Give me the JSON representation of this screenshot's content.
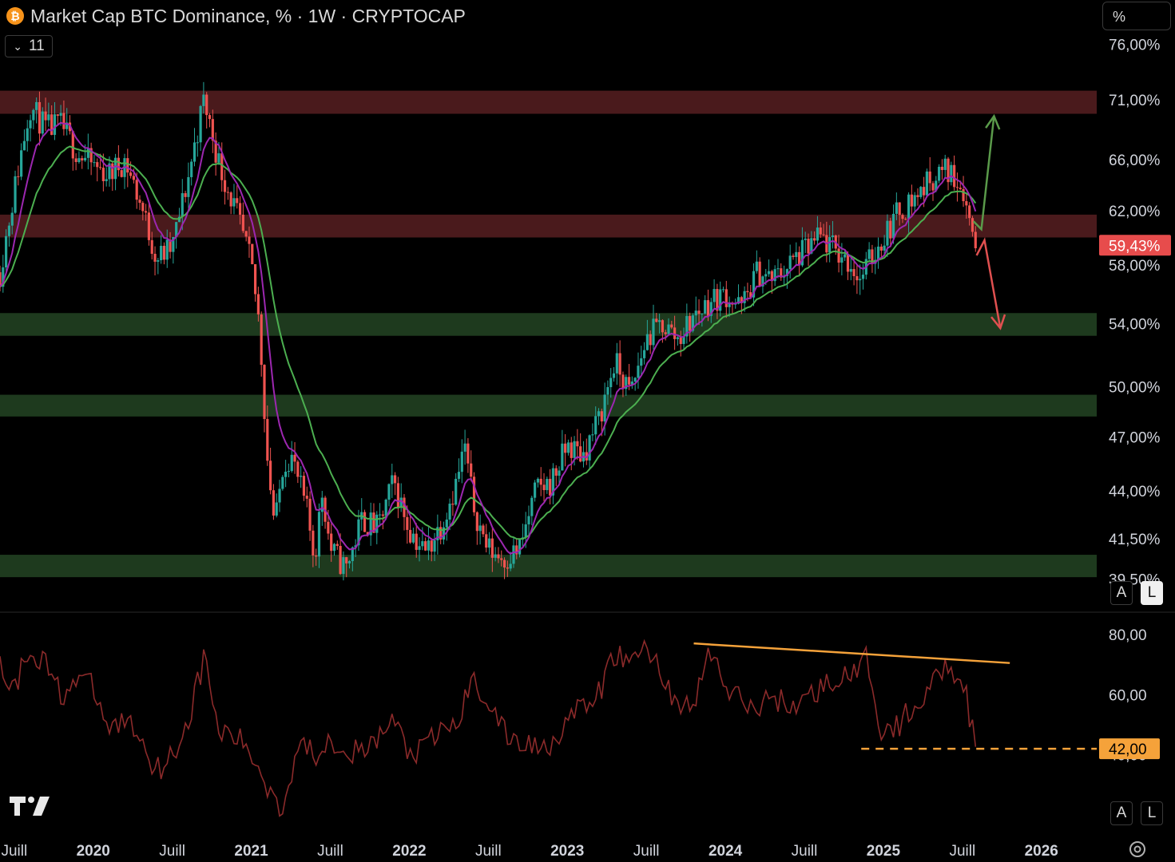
{
  "header": {
    "coin_icon": "bitcoin-icon",
    "title": "Market Cap BTC Dominance, % · 1W · CRYPTOCAP",
    "indicators_count": "11",
    "scale_label": "%"
  },
  "scale_buttons": {
    "auto": "A",
    "log": "L"
  },
  "colors": {
    "background": "#000000",
    "up_candle": "#26a69a",
    "down_candle": "#ef5350",
    "ema_fast": "#9c27b0",
    "ema_slow": "#4caf50",
    "resistance_zone": "#4a1a1c",
    "support_zone": "#1e3a1e",
    "rsi_line": "#8b2a2a",
    "trendline": "#f5a23a",
    "last_price_label": "#e74c4c"
  },
  "chart_data": [
    {
      "type": "candlestick",
      "title": "Market Cap BTC Dominance, % · 1W · CRYPTOCAP",
      "ylabel": "%",
      "y_scale": "log",
      "ylim": [
        38.2,
        77.0
      ],
      "y_ticks": [
        "76,00%",
        "71,00%",
        "66,00%",
        "62,00%",
        "58,00%",
        "54,00%",
        "50,00%",
        "47,00%",
        "44,00%",
        "41,50%",
        "39,50%"
      ],
      "y_tick_values": [
        76,
        71,
        66,
        62,
        58,
        54,
        50,
        47,
        44,
        41.5,
        39.5
      ],
      "x_ticks": [
        "Juill",
        "2020",
        "Juill",
        "2021",
        "Juill",
        "2022",
        "Juill",
        "2023",
        "Juill",
        "2024",
        "Juill",
        "2025",
        "Juill",
        "2026"
      ],
      "x_tick_values": [
        2019.5,
        2020.0,
        2020.5,
        2021.0,
        2021.5,
        2022.0,
        2022.5,
        2023.0,
        2023.5,
        2024.0,
        2024.5,
        2025.0,
        2025.5,
        2026.0
      ],
      "xlim": [
        2019.41,
        2026.35
      ],
      "last_value": 59.43,
      "last_value_label": "59,43%",
      "series": [
        {
          "name": "",
          "kind": "close",
          "x": [
            2019.41,
            2019.5,
            2019.6,
            2019.7,
            2019.8,
            2019.9,
            2020.0,
            2020.1,
            2020.2,
            2020.3,
            2020.4,
            2020.5,
            2020.6,
            2020.7,
            2020.8,
            2020.9,
            2020.95,
            2021.0,
            2021.05,
            2021.1,
            2021.15,
            2021.2,
            2021.25,
            2021.3,
            2021.35,
            2021.4,
            2021.45,
            2021.5,
            2021.6,
            2021.7,
            2021.8,
            2021.9,
            2022.0,
            2022.1,
            2022.2,
            2022.3,
            2022.35,
            2022.4,
            2022.45,
            2022.5,
            2022.6,
            2022.7,
            2022.8,
            2022.9,
            2023.0,
            2023.1,
            2023.2,
            2023.3,
            2023.4,
            2023.5,
            2023.6,
            2023.7,
            2023.8,
            2023.9,
            2024.0,
            2024.1,
            2024.2,
            2024.3,
            2024.4,
            2024.5,
            2024.6,
            2024.7,
            2024.8,
            2024.85,
            2024.9,
            2024.95,
            2025.0,
            2025.1,
            2025.2,
            2025.3,
            2025.4,
            2025.5,
            2025.55,
            2025.58,
            2025.6
          ],
          "y": [
            57.5,
            63.5,
            70.5,
            68.5,
            68.8,
            66.5,
            65.5,
            64.8,
            66.0,
            62.5,
            58.5,
            59.2,
            64.5,
            71.0,
            65.5,
            62.0,
            60.0,
            58.0,
            54.0,
            46.0,
            42.0,
            45.5,
            46.0,
            44.5,
            43.0,
            40.5,
            44.0,
            41.0,
            40.0,
            42.5,
            42.0,
            44.5,
            42.0,
            40.8,
            42.2,
            44.5,
            46.5,
            43.5,
            42.0,
            41.0,
            40.5,
            41.0,
            44.0,
            44.5,
            46.5,
            46.0,
            48.0,
            51.5,
            49.5,
            53.0,
            54.0,
            53.0,
            54.5,
            55.5,
            56.0,
            55.0,
            57.5,
            57.0,
            58.0,
            59.0,
            60.0,
            59.0,
            58.0,
            57.0,
            58.0,
            59.0,
            60.0,
            62.0,
            63.0,
            64.5,
            65.2,
            64.0,
            61.0,
            60.0,
            59.43
          ]
        },
        {
          "name": "",
          "kind": "ema_fast"
        },
        {
          "name": "",
          "kind": "ema_slow"
        }
      ],
      "zones": [
        {
          "kind": "resistance",
          "from": 69.8,
          "to": 71.8
        },
        {
          "kind": "resistance",
          "from": 60.0,
          "to": 61.7
        },
        {
          "kind": "support",
          "from": 53.2,
          "to": 54.7
        },
        {
          "kind": "support",
          "from": 48.2,
          "to": 49.5
        },
        {
          "kind": "support",
          "from": 39.6,
          "to": 40.7
        }
      ],
      "projections": [
        {
          "kind": "bullish",
          "color": "#5a9a4a",
          "path": [
            [
              2025.57,
              61.2
            ],
            [
              2025.62,
              60.6
            ],
            [
              2025.7,
              69.6
            ]
          ]
        },
        {
          "kind": "bearish",
          "color": "#e05050",
          "path": [
            [
              2025.59,
              58.7
            ],
            [
              2025.64,
              59.8
            ],
            [
              2025.74,
              53.7
            ]
          ]
        }
      ],
      "grid": false
    },
    {
      "type": "line",
      "title": "",
      "ylim": [
        15,
        85
      ],
      "y_ticks": [
        "80,00",
        "60,00",
        "40,00"
      ],
      "y_tick_values": [
        80,
        60,
        40
      ],
      "highlighted_level": "42,00",
      "highlighted_value": 42,
      "series": [
        {
          "name": "",
          "x": [
            2019.41,
            2019.5,
            2019.6,
            2019.7,
            2019.8,
            2019.9,
            2020.0,
            2020.1,
            2020.2,
            2020.3,
            2020.4,
            2020.5,
            2020.6,
            2020.7,
            2020.8,
            2020.9,
            2021.0,
            2021.1,
            2021.2,
            2021.3,
            2021.35,
            2021.4,
            2021.5,
            2021.6,
            2021.7,
            2021.8,
            2021.9,
            2022.0,
            2022.1,
            2022.2,
            2022.3,
            2022.4,
            2022.5,
            2022.6,
            2022.7,
            2022.8,
            2022.9,
            2023.0,
            2023.1,
            2023.2,
            2023.3,
            2023.4,
            2023.5,
            2023.6,
            2023.7,
            2023.8,
            2023.9,
            2024.0,
            2024.1,
            2024.2,
            2024.3,
            2024.4,
            2024.5,
            2024.6,
            2024.7,
            2024.8,
            2024.9,
            2025.0,
            2025.1,
            2025.2,
            2025.3,
            2025.4,
            2025.45,
            2025.5,
            2025.55,
            2025.6
          ],
          "y": [
            70,
            62,
            76,
            70,
            60,
            66,
            62,
            48,
            52,
            46,
            35,
            40,
            51,
            72,
            47,
            46,
            40,
            30,
            22,
            45,
            42,
            40,
            46,
            42,
            40,
            45,
            52,
            40,
            42,
            48,
            50,
            65,
            58,
            47,
            44,
            43,
            44,
            52,
            55,
            60,
            74,
            70,
            77,
            66,
            57,
            55,
            76,
            62,
            58,
            55,
            60,
            56,
            58,
            62,
            66,
            65,
            72,
            45,
            50,
            57,
            62,
            72,
            67,
            66,
            52,
            38
          ]
        }
      ],
      "trendline": {
        "from": [
          2023.8,
          77.0
        ],
        "to": [
          2025.8,
          70.5
        ]
      }
    }
  ]
}
